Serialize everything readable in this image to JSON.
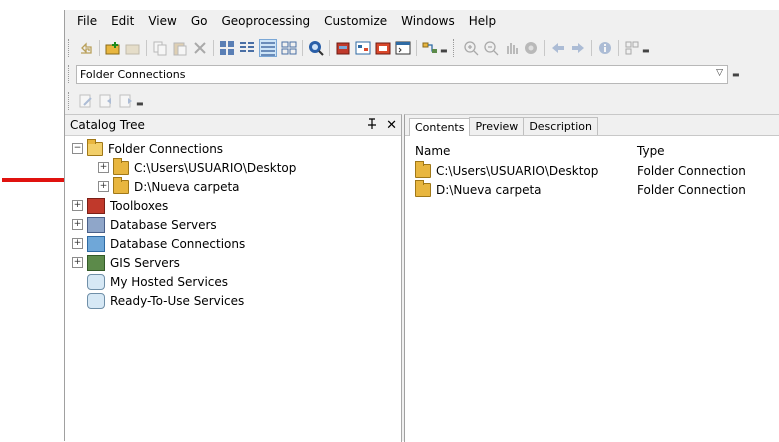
{
  "menubar": {
    "items": [
      "File",
      "Edit",
      "View",
      "Go",
      "Geoprocessing",
      "Customize",
      "Windows",
      "Help"
    ]
  },
  "toolbar": {
    "icons": [
      "up-one-level-icon",
      "connect-folder-icon",
      "disconnect-folder-icon",
      "copy-icon",
      "paste-icon",
      "delete-icon",
      "large-icons-view-icon",
      "list-view-icon",
      "details-view-icon",
      "thumbnails-view-icon",
      "search-icon",
      "arctoolbox-icon",
      "model-builder-icon",
      "geoprocessing-results-icon",
      "python-window-icon",
      "metadata-icon",
      "zoom-in-icon",
      "zoom-out-icon",
      "pan-icon",
      "full-extent-icon",
      "back-icon",
      "forward-icon",
      "identify-icon",
      "create-thumbnail-icon"
    ]
  },
  "location": {
    "value": "Folder Connections"
  },
  "catalog": {
    "title": "Catalog Tree",
    "pin_glyph": "⁠†",
    "close_glyph": "✕",
    "tree": [
      {
        "label": "Folder Connections",
        "expander": "−",
        "icon": "folder-connections-icon"
      },
      {
        "label": "C:\\Users\\USUARIO\\Desktop",
        "expander": "+",
        "icon": "folder-icon"
      },
      {
        "label": "D:\\Nueva carpeta",
        "expander": "+",
        "icon": "folder-icon"
      },
      {
        "label": "Toolboxes",
        "expander": "+",
        "icon": "toolbox-icon"
      },
      {
        "label": "Database Servers",
        "expander": "+",
        "icon": "database-server-icon"
      },
      {
        "label": "Database Connections",
        "expander": "+",
        "icon": "database-connection-icon"
      },
      {
        "label": "GIS Servers",
        "expander": "+",
        "icon": "gis-server-icon"
      },
      {
        "label": "My Hosted Services",
        "expander": "",
        "icon": "hosted-services-icon"
      },
      {
        "label": "Ready-To-Use Services",
        "expander": "",
        "icon": "ready-to-use-services-icon"
      }
    ]
  },
  "content": {
    "tabs": [
      "Contents",
      "Preview",
      "Description"
    ],
    "columns": [
      "Name",
      "Type"
    ],
    "rows": [
      {
        "name": "C:\\Users\\USUARIO\\Desktop",
        "type": "Folder Connection"
      },
      {
        "name": "D:\\Nueva carpeta",
        "type": "Folder Connection"
      }
    ]
  },
  "colors": {
    "annotation_arrow": "#e0120f",
    "folder": "#e8b63f"
  }
}
